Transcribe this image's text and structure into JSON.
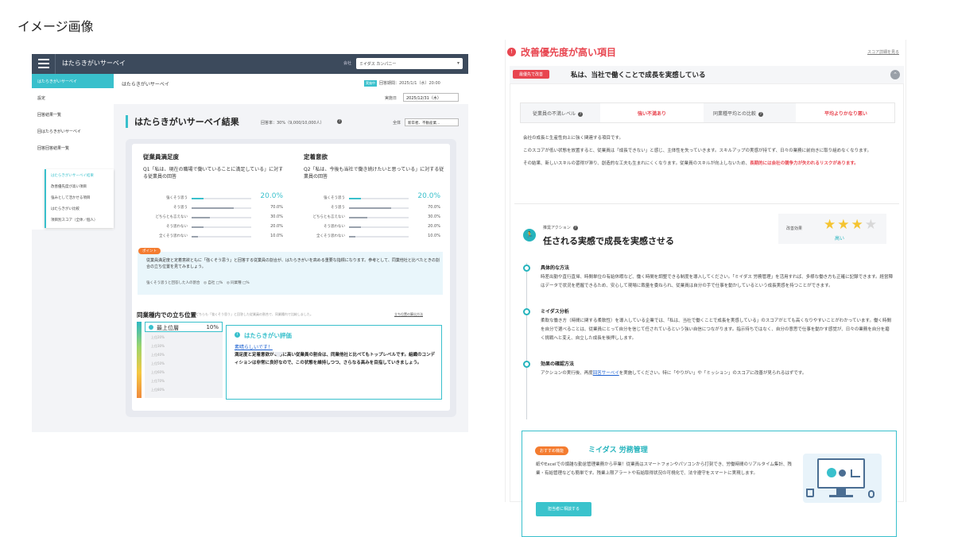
{
  "page_title": "イメージ画像",
  "left": {
    "brand": "はたらきがいサーベイ",
    "company_label": "会社",
    "company_value": "ミイダス カンパニー",
    "sidebar": {
      "active": "はたらきがいサーベイ",
      "items": [
        "設定",
        "回答結果一覧",
        "回はたらきがいサーベイ",
        "回答回答結果一覧"
      ],
      "sub": [
        "はたらきがいサーベイ結果",
        "改善優先度が高い項目",
        "強みとして活かせる項目",
        "はたらきがい比較",
        "項目別スコア（全体／個人）"
      ]
    },
    "header": {
      "title": "はたらきがいサーベイ",
      "badge": "実施中",
      "period": "回答期間：2025/1/1（水）20:00",
      "date_label": "実施日",
      "date_value": "2025/12/31（木）"
    },
    "result_title": "はたらきがいサーベイ結果",
    "response_rate": "回答率：30%（9,000/10,000人）",
    "filter_label": "全体",
    "filter_value": "新卒者、不動産業…",
    "col1": {
      "h": "従業員満足度",
      "q": "Q1「私は、現在の職場で働いていることに満足している」に対する従業員の回答"
    },
    "col2": {
      "h": "定着意欲",
      "q": "Q2「私は、今後も当社で働き続けたいと思っている」に対する従業員の回答"
    },
    "scale_rows": [
      {
        "label": "強くそう思う",
        "v1": "20.0%",
        "v2": "20.0%",
        "f1": 0.2,
        "f2": 0.2
      },
      {
        "label": "そう思う",
        "v1": "70.0%",
        "v2": "70.0%",
        "f1": 0.7,
        "f2": 0.7
      },
      {
        "label": "どちらとも言えない",
        "v1": "30.0%",
        "v2": "30.0%",
        "f1": 0.3,
        "f2": 0.3
      },
      {
        "label": "そう思わない",
        "v1": "20.0%",
        "v2": "20.0%",
        "f1": 0.2,
        "f2": 0.2
      },
      {
        "label": "全くそう思わない",
        "v1": "10.0%",
        "v2": "10.0%",
        "f1": 0.1,
        "f2": 0.1
      }
    ],
    "point": {
      "badge": "ポイント",
      "text": "従業員満足度と定着意欲ともに「強くそう思う」と回答する従業員の割合が、はたらきがいを高める重要な指標になります。参考として、同業他社と比べたときの割合の立ち位置を見てみましょう。",
      "footer": "強くそう思うと回答した人の割合　◎ 自社 □%　◎ 同業種 □%"
    },
    "position": {
      "title": "同業種内での立ち位置",
      "note": "どちらも「強くそう思う」と回答した従業員の割合で、同業種内で比較しました。",
      "link": "立ち位置の算出方法",
      "top_label": "最上位層",
      "top_pct": "10%",
      "ranks": [
        "上位20%",
        "上位30%",
        "上位40%",
        "上位50%",
        "上位60%",
        "上位70%",
        "上位80%"
      ]
    },
    "evaluation": {
      "title": "はたらきがい評価",
      "headline": "素晴らしいです！",
      "body": "満足度と定着意欲がともに高い従業員の割合は、同業他社と比べてもトップレベルです。組織のコンディションは非常に良好なので、この状態を維持しつつ、さらなる高みを目指していきましょう。"
    }
  },
  "right": {
    "title": "改善優先度が高い項目",
    "link": "スコア詳細を見る",
    "tag": "最優先で改善",
    "heading": "私は、当社で働くことで成長を実感している",
    "table": {
      "c1": "従業員の不満レベル",
      "c2": "強い不満あり",
      "c3": "同業種平均との比較",
      "c4": "平均よりかなり悪い"
    },
    "desc": [
      "会社の成長と生産性向上に強く関連する項目です。",
      "このスコアが低い状態を放置すると、従業員は「成長できない」と感じ、主体性を失っていきます。スキルアップの実感が持てず、日々の業務に前向きに取り組めなくなります。"
    ],
    "desc3_a": "その結果、新しいスキルの習得が滞り、創造的な工夫も生まれにくくなります。従業員のスキルが向上しないため、",
    "desc3_b": "長期的には会社の競争力が失われるリスクがあります。",
    "action_label": "推奨アクション",
    "action_title": "任される実感で成長を実感させる",
    "effect_label": "改善効果",
    "effect_stars": 3,
    "effect_max": 4,
    "effect_value": "高い",
    "sec1": {
      "t": "具体的な方法",
      "b": "時差出勤や直行直帰、時間単位の有給休暇など、働く時間を調整できる制度を導入してください。「ミイダス 労務管理」を活用すれば、多様な働き方も正確に記録できます。経営陣はデータで状況を把握できるため、安心して現場に裁量を委ねられ、従業員は自分の手で仕事を動かしているという成長実感を持つことができます。"
    },
    "sec2": {
      "t": "ミイダス分析",
      "b": "柔軟な働き方（時間に関する柔軟性）を導入している企業では、「私は、当社で働くことで成長を実感している」のスコアがとても高くなりやすいことがわかっています。働く時間を自分で選べることは、従業員にとって自分を信じて任されているという強い自信につながります。指示待ちではなく、自分の意思で仕事を動かす感覚が、日々の業務を自分を磨く挑戦へと変え、自立した成長を後押しします。"
    },
    "sec3": {
      "t": "効果の確認方法",
      "b_a": "アクションの実行後、再度",
      "b_link": "回答サーベイ",
      "b_b": "を実施してください。特に「やりがい」や「ミッション」のスコアに改善が見られるはずです。"
    },
    "rec": {
      "badge": "おすすめ機能",
      "title": "ミイダス 労務管理",
      "desc": "紙やExcelでの煩雑な勤怠管理業務から卒業！従業員はスマートフォンやパソコンから打刻でき、労働時間のリアルタイム集計、残業・有給管理なども簡単です。残業上限アラートや有給取得状況の可視化で、法令遵守をスマートに実現します。",
      "button": "担当者に相談する"
    }
  }
}
